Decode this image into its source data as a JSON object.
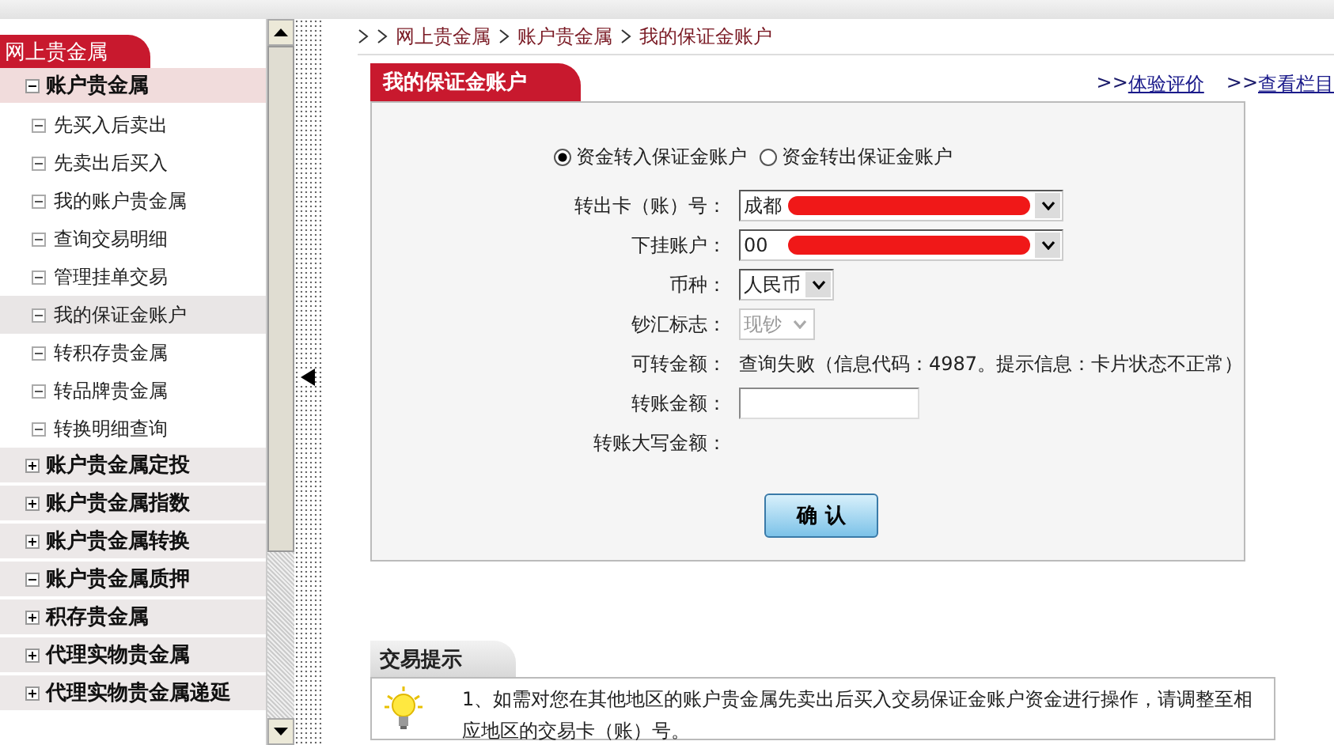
{
  "sidebar": {
    "title": "网上贵金属",
    "groups": [
      {
        "label": "账户贵金属",
        "expanded": true,
        "children": [
          {
            "label": "先买入后卖出",
            "selected": false
          },
          {
            "label": "先卖出后买入",
            "selected": false
          },
          {
            "label": "我的账户贵金属",
            "selected": false
          },
          {
            "label": "查询交易明细",
            "selected": false
          },
          {
            "label": "管理挂单交易",
            "selected": false
          },
          {
            "label": "我的保证金账户",
            "selected": true
          },
          {
            "label": "转积存贵金属",
            "selected": false
          },
          {
            "label": "转品牌贵金属",
            "selected": false
          },
          {
            "label": "转换明细查询",
            "selected": false
          }
        ]
      },
      {
        "label": "账户贵金属定投",
        "expanded": false
      },
      {
        "label": "账户贵金属指数",
        "expanded": false
      },
      {
        "label": "账户贵金属转换",
        "expanded": false
      },
      {
        "label": "账户贵金属质押",
        "expanded": true
      },
      {
        "label": "积存贵金属",
        "expanded": false
      },
      {
        "label": "代理实物贵金属",
        "expanded": false
      },
      {
        "label": "代理实物贵金属递延",
        "expanded": false
      }
    ]
  },
  "breadcrumb": [
    "网上贵金属",
    "账户贵金属",
    "我的保证金账户"
  ],
  "panel": {
    "title": "我的保证金账户",
    "links": [
      {
        "prefix": ">>",
        "label": "体验评价"
      },
      {
        "prefix": ">>",
        "label": "查看栏目"
      }
    ],
    "radios": [
      {
        "label": "资金转入保证金账户",
        "selected": true
      },
      {
        "label": "资金转出保证金账户",
        "selected": false
      }
    ],
    "fields": [
      {
        "kind": "select",
        "label": "转出卡（账）号：",
        "value": "成都",
        "disabled": false,
        "redacted": true
      },
      {
        "kind": "select",
        "label": "下挂账户：",
        "value": "00",
        "disabled": false,
        "redacted": true
      },
      {
        "kind": "select",
        "label": "币种：",
        "value": "人民币",
        "disabled": false
      },
      {
        "kind": "select",
        "label": "钞汇标志：",
        "value": "现钞",
        "disabled": true
      },
      {
        "kind": "text",
        "label": "可转金额：",
        "value": "查询失败（信息代码：4987。提示信息：卡片状态不正常）"
      },
      {
        "kind": "input",
        "label": "转账金额："
      },
      {
        "kind": "blank",
        "label": "转账大写金额："
      }
    ],
    "button": "确 认"
  },
  "tips": {
    "title": "交易提示",
    "items": [
      "1、如需对您在其他地区的账户贵金属先卖出后买入交易保证金账户资金进行操作，请调整至相应地区的交易卡（账）号。"
    ]
  }
}
